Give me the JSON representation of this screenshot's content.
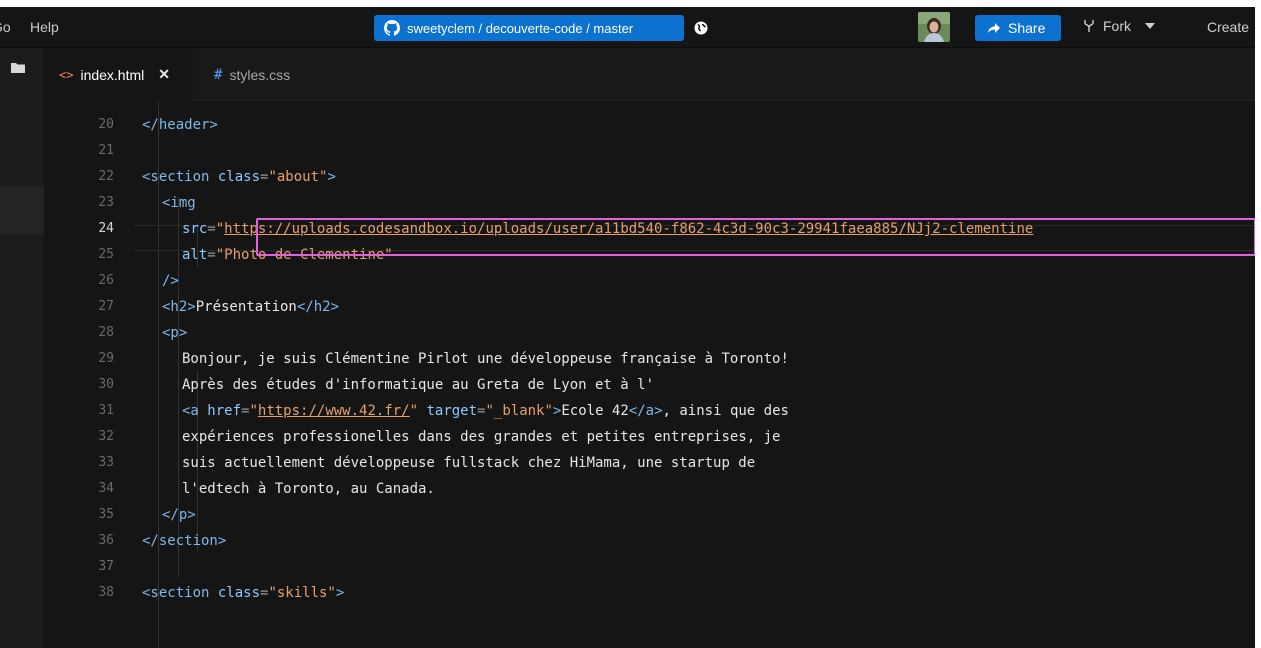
{
  "menu": {
    "go_label": "Go",
    "help_label": "Help"
  },
  "repo": {
    "label": "sweetyclem / decouverte-code / master"
  },
  "actions": {
    "share_label": "Share",
    "fork_label": "Fork",
    "create_label": "Create"
  },
  "tabs": [
    {
      "label": "index.html",
      "icon": "<>",
      "active": true
    },
    {
      "label": "styles.css",
      "icon": "#",
      "active": false
    }
  ],
  "editor": {
    "current_line": 24,
    "lines": [
      {
        "num": "20",
        "indent": 1,
        "tokens": [
          [
            "tag",
            "</header>"
          ]
        ]
      },
      {
        "num": "21",
        "indent": 0,
        "tokens": []
      },
      {
        "num": "22",
        "indent": 1,
        "tokens": [
          [
            "tag",
            "<section "
          ],
          [
            "attr",
            "class"
          ],
          [
            "punc",
            "="
          ],
          [
            "str",
            "\"about\""
          ],
          [
            "tag",
            ">"
          ]
        ]
      },
      {
        "num": "23",
        "indent": 2,
        "tokens": [
          [
            "tag",
            "<img"
          ]
        ]
      },
      {
        "num": "24",
        "indent": 3,
        "tokens": [
          [
            "attr",
            "src"
          ],
          [
            "punc",
            "="
          ],
          [
            "str",
            "\""
          ],
          [
            "url",
            "https://uploads.codesandbox.io/uploads/user/a11bd540-f862-4c3d-90c3-29941faea885/NJj2-clementine"
          ]
        ]
      },
      {
        "num": "25",
        "indent": 3,
        "tokens": [
          [
            "attr",
            "alt"
          ],
          [
            "punc",
            "="
          ],
          [
            "str",
            "\"Photo de Clementine\""
          ]
        ]
      },
      {
        "num": "26",
        "indent": 2,
        "tokens": [
          [
            "tag",
            "/>"
          ]
        ]
      },
      {
        "num": "27",
        "indent": 2,
        "tokens": [
          [
            "tag",
            "<h2>"
          ],
          [
            "txt",
            "Présentation"
          ],
          [
            "tag",
            "</h2>"
          ]
        ]
      },
      {
        "num": "28",
        "indent": 2,
        "tokens": [
          [
            "tag",
            "<p>"
          ]
        ]
      },
      {
        "num": "29",
        "indent": 3,
        "tokens": [
          [
            "txt",
            "Bonjour, je suis Clémentine Pirlot une développeuse française à Toronto!"
          ]
        ]
      },
      {
        "num": "30",
        "indent": 3,
        "tokens": [
          [
            "txt",
            "Après des études d'informatique au Greta de Lyon et à l'"
          ]
        ]
      },
      {
        "num": "31",
        "indent": 3,
        "tokens": [
          [
            "tag",
            "<a "
          ],
          [
            "attr",
            "href"
          ],
          [
            "punc",
            "="
          ],
          [
            "str",
            "\""
          ],
          [
            "url",
            "https://www.42.fr/"
          ],
          [
            "str",
            "\" "
          ],
          [
            "attr",
            "target"
          ],
          [
            "punc",
            "="
          ],
          [
            "str",
            "\"_blank\""
          ],
          [
            "tag",
            ">"
          ],
          [
            "txt",
            "Ecole 42"
          ],
          [
            "tag",
            "</a>"
          ],
          [
            "txt",
            ", ainsi que des"
          ]
        ]
      },
      {
        "num": "32",
        "indent": 3,
        "tokens": [
          [
            "txt",
            "expériences professionelles dans des grandes et petites entreprises, je"
          ]
        ]
      },
      {
        "num": "33",
        "indent": 3,
        "tokens": [
          [
            "txt",
            "suis actuellement développeuse fullstack chez HiMama, une startup de"
          ]
        ]
      },
      {
        "num": "34",
        "indent": 3,
        "tokens": [
          [
            "txt",
            "l'edtech à Toronto, au Canada."
          ]
        ]
      },
      {
        "num": "35",
        "indent": 2,
        "tokens": [
          [
            "tag",
            "</p>"
          ]
        ]
      },
      {
        "num": "36",
        "indent": 1,
        "tokens": [
          [
            "tag",
            "</section>"
          ]
        ]
      },
      {
        "num": "37",
        "indent": 0,
        "tokens": []
      },
      {
        "num": "38",
        "indent": 1,
        "tokens": [
          [
            "tag",
            "<section "
          ],
          [
            "attr",
            "class"
          ],
          [
            "punc",
            "="
          ],
          [
            "str",
            "\"skills\""
          ],
          [
            "tag",
            ">"
          ]
        ]
      }
    ]
  },
  "colors": {
    "accent": "#0d72cf",
    "highlight": "#e060e0",
    "background": "#151515"
  }
}
